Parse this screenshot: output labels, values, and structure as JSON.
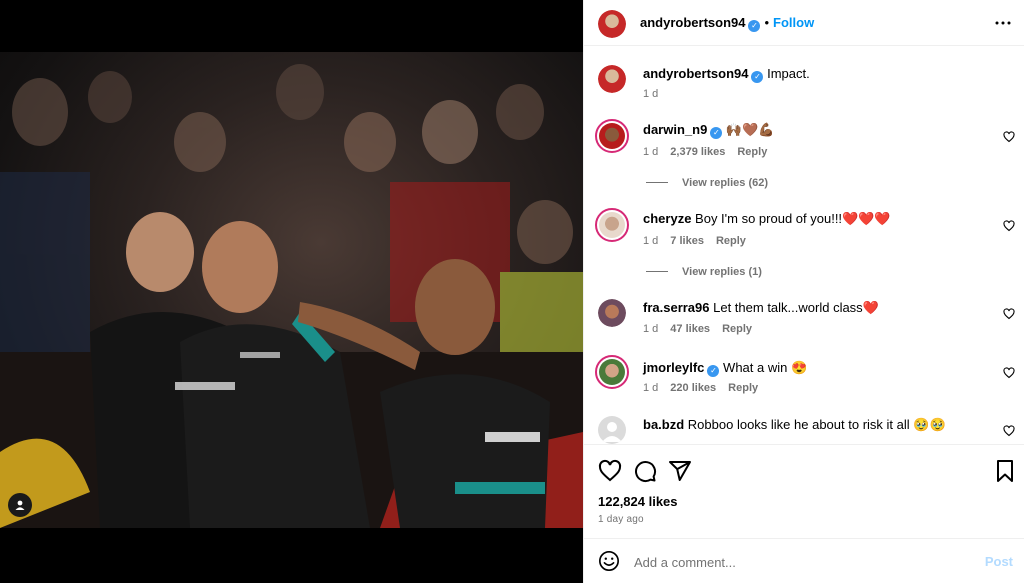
{
  "post": {
    "author": "andyrobertson94",
    "follow_label": "Follow",
    "caption": "Impact.",
    "caption_age": "1 d",
    "likes": "122,824 likes",
    "date": "1 day ago"
  },
  "comments": [
    {
      "user": "darwin_n9",
      "verified": true,
      "text": "🙌🏾🤎💪🏾",
      "age": "1 d",
      "likes": "2,379 likes",
      "reply": "Reply",
      "view_replies": "View replies (62)"
    },
    {
      "user": "cheryze",
      "verified": false,
      "text": "Boy I'm so proud of you!!!❤️❤️❤️",
      "age": "1 d",
      "likes": "7 likes",
      "reply": "Reply",
      "view_replies": "View replies (1)"
    },
    {
      "user": "fra.serra96",
      "verified": false,
      "text": "Let them talk...world class❤️",
      "age": "1 d",
      "likes": "47 likes",
      "reply": "Reply"
    },
    {
      "user": "jmorleylfc",
      "verified": true,
      "text": "What a win 😍",
      "age": "1 d",
      "likes": "220 likes",
      "reply": "Reply"
    },
    {
      "user": "ba.bzd",
      "verified": false,
      "text": "Robboo looks like he about to risk it all 🥹🥹",
      "age": "1 d",
      "likes": "",
      "reply": ""
    }
  ],
  "compose": {
    "placeholder": "Add a comment...",
    "post_label": "Post"
  },
  "colors": {
    "link": "#0095f6",
    "verified": "#3897f0",
    "muted": "#737373",
    "post_disabled": "#b3dbff"
  },
  "icons": {
    "more": "more-options-icon",
    "like": "heart-icon",
    "comment": "comment-icon",
    "share": "share-icon",
    "save": "bookmark-icon",
    "emoji": "emoji-icon",
    "tag": "user-tag-icon"
  }
}
